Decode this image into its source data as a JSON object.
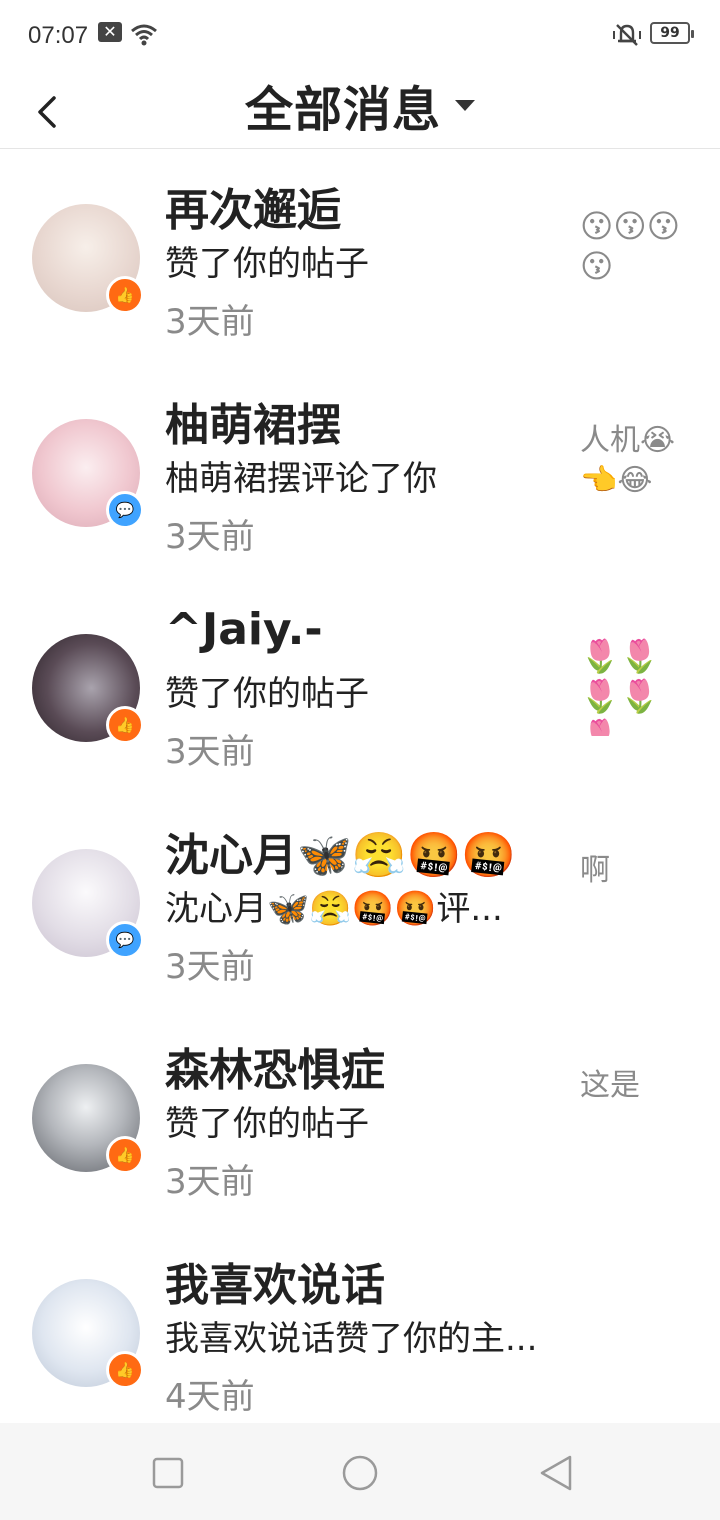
{
  "status": {
    "time": "07:07",
    "battery": "99",
    "icons": [
      "notification-x-icon",
      "wifi-icon",
      "silent-bell-icon",
      "battery-icon"
    ]
  },
  "header": {
    "title": "全部消息",
    "back_icon": "chevron-left-icon",
    "dropdown_icon": "caret-down-icon"
  },
  "colors": {
    "like_badge": "#ff6a13",
    "comment_badge": "#3fa3ff",
    "secondary_text": "#8a8a8a"
  },
  "messages": [
    {
      "name": "再次邂逅",
      "desc": "赞了你的帖子",
      "time": "3天前",
      "badge": "like",
      "preview": "😗😗😗😗",
      "avatar_color": "#e8d7d0"
    },
    {
      "name": "柚萌裙摆",
      "desc": "柚萌裙摆评论了你",
      "time": "3天前",
      "badge": "comment",
      "preview": "人机😭👈😂",
      "avatar_color": "#f0c7cf"
    },
    {
      "name": "^Jaiy.-",
      "desc": "赞了你的帖子",
      "time": "3天前",
      "badge": "like",
      "preview": "🌷🌷🌷🌷🌷...",
      "avatar_color": "#5a4b56"
    },
    {
      "name": "沈心月🦋😤🤬🤬",
      "desc": "沈心月🦋😤🤬🤬评...",
      "time": "3天前",
      "badge": "comment",
      "preview": "啊",
      "avatar_color": "#e2dde6"
    },
    {
      "name": "森林恐惧症",
      "desc": "赞了你的帖子",
      "time": "3天前",
      "badge": "like",
      "preview": "这是",
      "avatar_color": "#8a8d93"
    },
    {
      "name": "我喜欢说话",
      "desc": "我喜欢说话赞了你的主...",
      "time": "4天前",
      "badge": "like",
      "preview": "",
      "avatar_color": "#dfe6f0"
    }
  ],
  "navbar": {
    "icons": [
      "recent-apps-icon",
      "home-icon",
      "back-icon"
    ]
  }
}
